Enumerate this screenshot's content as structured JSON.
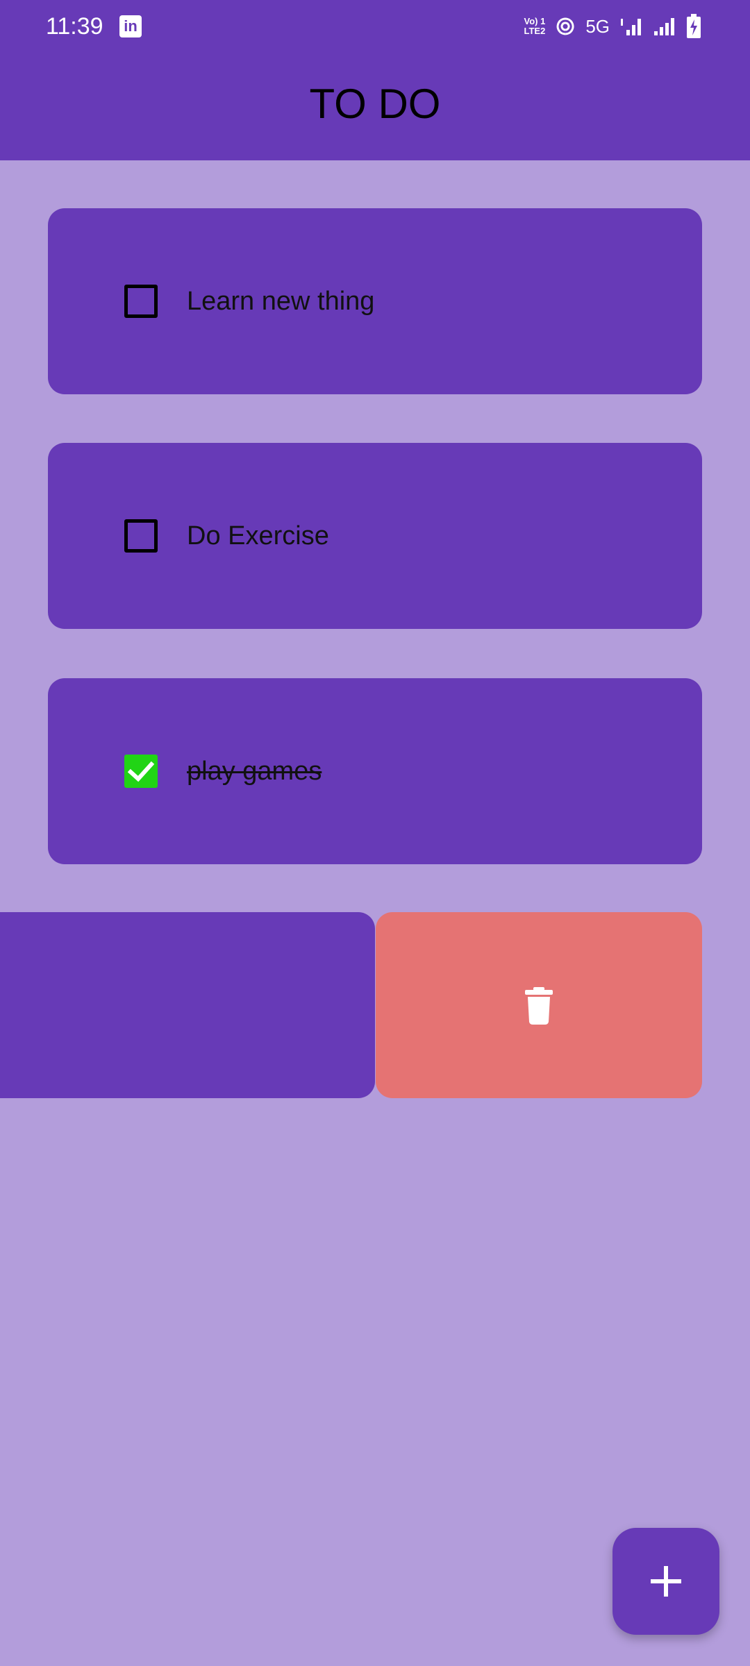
{
  "status_bar": {
    "time": "11:39",
    "app_badge": "in",
    "volte_line1": "Vo) 1",
    "volte_line2": "LTE2",
    "network": "5G"
  },
  "appbar": {
    "title": "TO DO"
  },
  "tasks": [
    {
      "label": "Learn new thing",
      "checked": false
    },
    {
      "label": "Do Exercise",
      "checked": false
    },
    {
      "label": "play games",
      "checked": true
    }
  ],
  "icons": {
    "delete": "trash-icon",
    "add": "plus-icon",
    "check": "checkmark-icon"
  },
  "colors": {
    "primary": "#673AB7",
    "background": "#B39DDB",
    "delete_bg": "#E57373",
    "checked": "#21D415"
  }
}
